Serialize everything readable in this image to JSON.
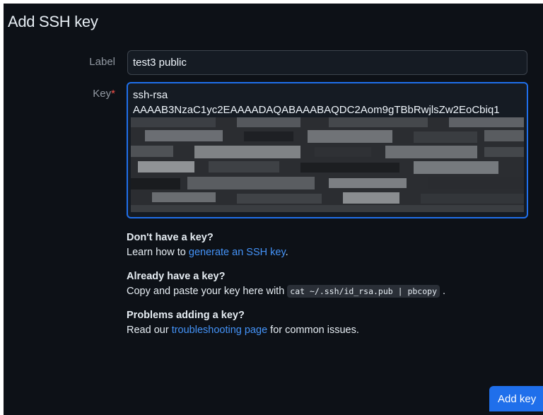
{
  "dialog": {
    "title": "Add SSH key"
  },
  "form": {
    "label_field": {
      "label": "Label",
      "value": "test3 public"
    },
    "key_field": {
      "label": "Key",
      "required_marker": "*",
      "line1": "ssh-rsa",
      "line2": "AAAAB3NzaC1yc2EAAAADAQABAAABAQDC2Aom9gTBbRwjlsZw2EoCbiq1"
    }
  },
  "help": {
    "no_key": {
      "heading": "Don't have a key?",
      "text_before": "Learn how to ",
      "link": "generate an SSH key",
      "text_after": "."
    },
    "have_key": {
      "heading": "Already have a key?",
      "text_before": "Copy and paste your key here with ",
      "code": "cat ~/.ssh/id_rsa.pub | pbcopy",
      "text_after": " ."
    },
    "problems": {
      "heading": "Problems adding a key?",
      "text_before": "Read our ",
      "link": "troubleshooting page",
      "text_after": " for common issues."
    }
  },
  "actions": {
    "submit_label": "Add key"
  }
}
